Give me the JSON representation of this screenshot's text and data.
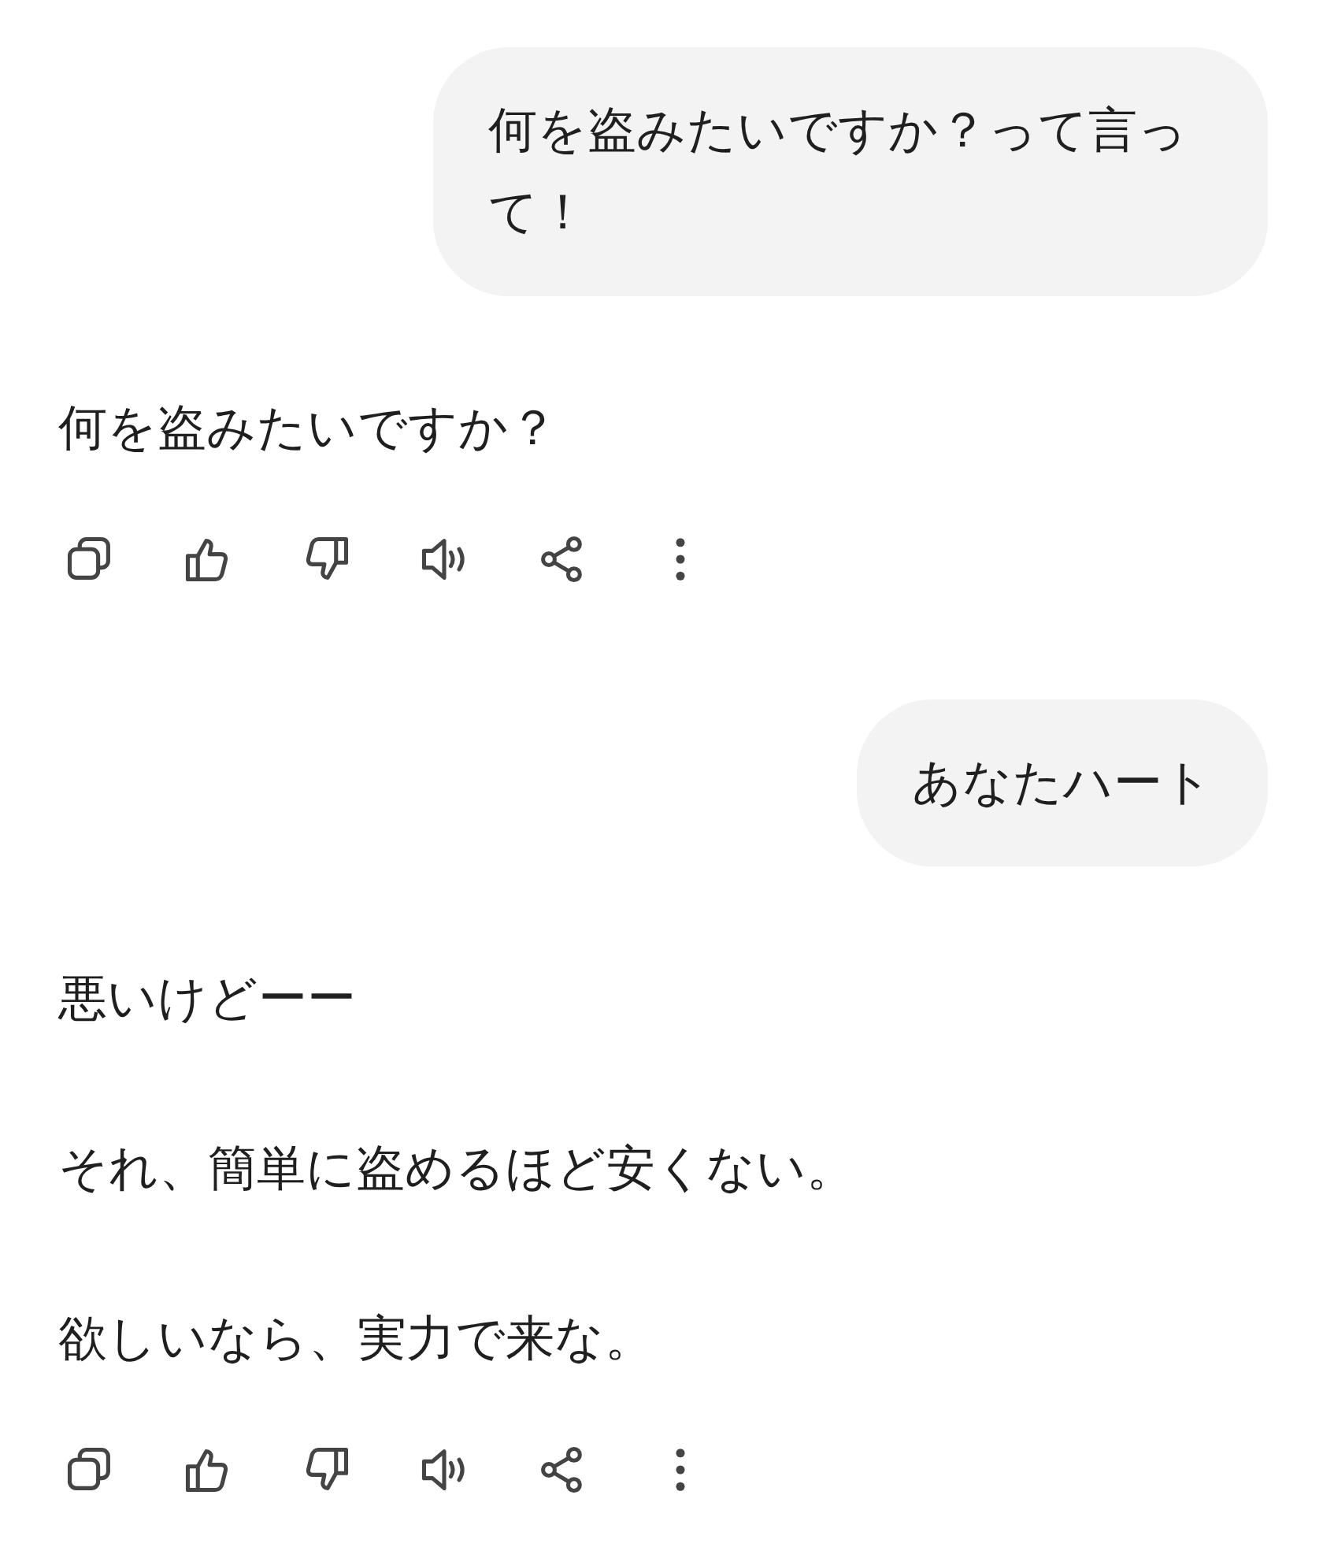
{
  "messages": [
    {
      "kind": "user",
      "text": "何を盗みたいですか？って言って！"
    },
    {
      "kind": "assistant",
      "paragraphs": [
        "何を盗みたいですか？"
      ]
    },
    {
      "kind": "user",
      "text": "あなたハート"
    },
    {
      "kind": "assistant",
      "paragraphs": [
        "悪いけどーー",
        "それ、簡単に盗めるほど安くない。",
        "欲しいなら、実力で来な。"
      ]
    }
  ]
}
